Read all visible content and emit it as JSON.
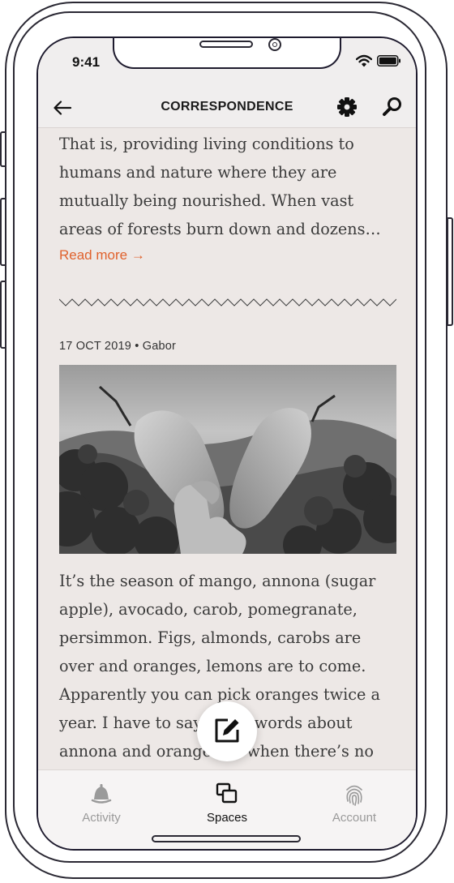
{
  "status_bar": {
    "time": "9:41"
  },
  "nav": {
    "title": "CORRESPONDENCE"
  },
  "post_prev": {
    "lines": [
      "That is, providing living conditions to",
      "humans and nature where they are",
      "mutually being nourished. When vast",
      "areas of forests burn down and dozens…"
    ],
    "read_more": "Read more →"
  },
  "post": {
    "meta": "17 OCT 2019 • Gabor",
    "lines": [
      "It’s the season of mango, annona (sugar",
      "apple), avocado, carob, pomegranate,",
      "persimmon. Figs, almonds, carobs are",
      "over and oranges, lemons are to come.",
      "Apparently you can pick oranges twice a",
      "year. I have to say a few words about",
      "annona and oranges so when there’s no"
    ]
  },
  "tabs": [
    {
      "label": "Activity",
      "icon": "bell-icon",
      "active": false
    },
    {
      "label": "Spaces",
      "icon": "spaces-icon",
      "active": true
    },
    {
      "label": "Account",
      "icon": "fingerprint-icon",
      "active": false
    }
  ],
  "colors": {
    "accent": "#e0622d",
    "background": "#ede8e6",
    "text": "#3a3a3a",
    "inactive_tab": "#9a9a9a"
  }
}
